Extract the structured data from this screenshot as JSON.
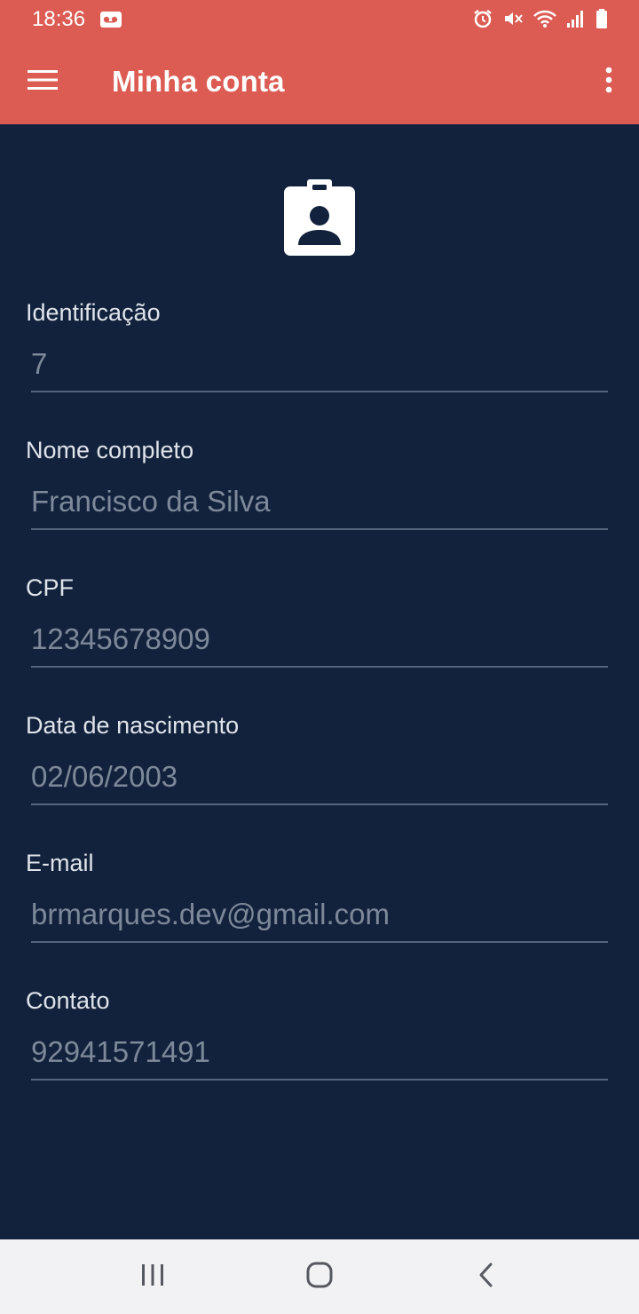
{
  "status_bar": {
    "time": "18:36",
    "icons": [
      "voicemail-icon",
      "alarm-icon",
      "vibrate-mute-icon",
      "wifi-icon",
      "signal-icon",
      "battery-icon"
    ]
  },
  "app_bar": {
    "title": "Minha conta",
    "menu_icon": "hamburger-menu-icon",
    "overflow_icon": "more-vert-icon",
    "color": "#dc5c54"
  },
  "profile": {
    "icon": "badge-account-icon",
    "fields": [
      {
        "label": "Identificação",
        "value": "7"
      },
      {
        "label": "Nome completo",
        "value": "Francisco da Silva"
      },
      {
        "label": "CPF",
        "value": "12345678909"
      },
      {
        "label": "Data de nascimento",
        "value": "02/06/2003"
      },
      {
        "label": "E-mail",
        "value": "brmarques.dev@gmail.com"
      },
      {
        "label": "Contato",
        "value": "92941571491"
      }
    ]
  },
  "nav_bar": {
    "buttons": [
      "recent-apps-icon",
      "home-icon",
      "back-icon"
    ]
  },
  "colors": {
    "background": "#12223d",
    "accent": "#dc5c54",
    "label_text": "#dfe4ea",
    "input_text": "#7d899a"
  }
}
